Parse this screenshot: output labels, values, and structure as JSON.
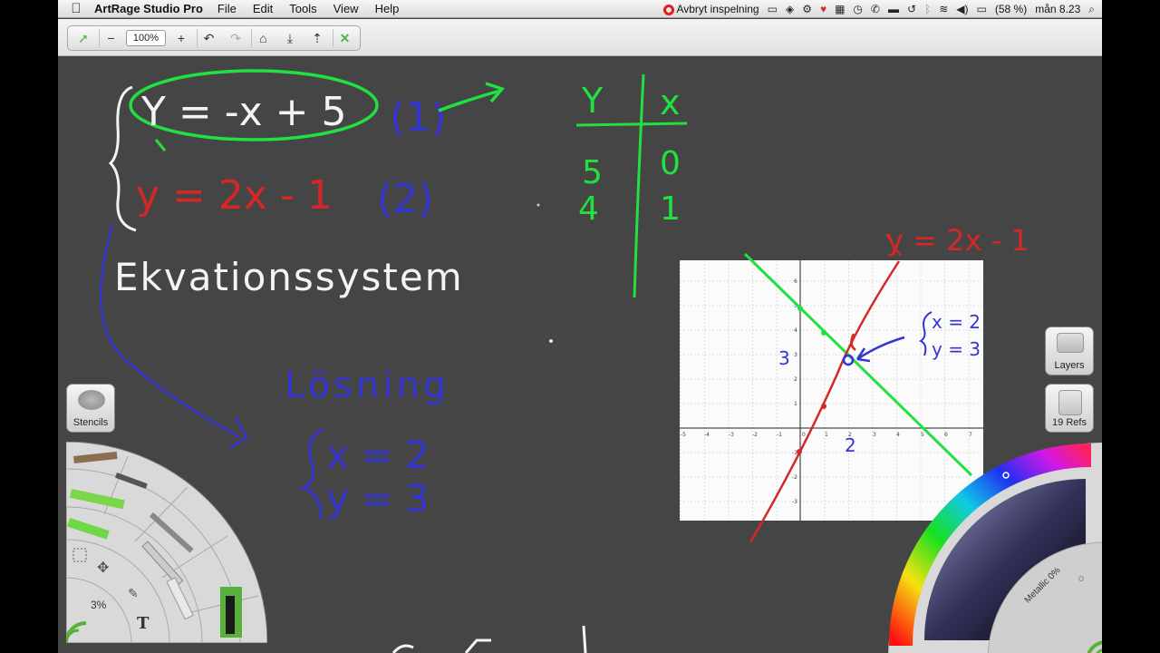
{
  "menubar": {
    "apple_icon": "apple-logo",
    "app_name": "ArtRage Studio Pro",
    "items": [
      "File",
      "Edit",
      "Tools",
      "View",
      "Help"
    ],
    "recording_label": "Avbryt inspelning",
    "battery": "(58 %)",
    "clock": "mån 8.23"
  },
  "toolbar": {
    "zoom": "100%",
    "buttons": [
      "pan-icon",
      "zoom-out",
      "zoom-in",
      "undo",
      "redo",
      "canvas-settings",
      "import",
      "export",
      "close"
    ]
  },
  "canvas": {
    "system_eq1": "Y = -x + 5",
    "system_eq1_tag": "(1)",
    "system_eq2": "y = 2x - 1",
    "system_eq2_tag": "(2)",
    "heading": "Ekvationssystem",
    "solution_label": "Lösning",
    "solution_x": "x = 2",
    "solution_y": "y = 3",
    "table": {
      "headers": [
        "Y",
        "x"
      ],
      "rows": [
        [
          "5",
          "0"
        ],
        [
          "4",
          "1"
        ]
      ]
    },
    "graph_label": "y = 2x - 1",
    "graph_point_label_x": "x = 2",
    "graph_point_label_y": "y = 3",
    "graph_y_mark": "3",
    "graph_x_mark": "2"
  },
  "panels": {
    "stencils_label": "Stencils",
    "layers_label": "Layers",
    "refs_label": "19 Refs",
    "brush_size": "3%",
    "metallic": "Metallic 0%"
  },
  "colors": {
    "canvas": "#454545",
    "green_ink": "#22e040",
    "red_ink": "#d42828",
    "blue_ink": "#3535d0",
    "white_ink": "#f4f4f4"
  }
}
